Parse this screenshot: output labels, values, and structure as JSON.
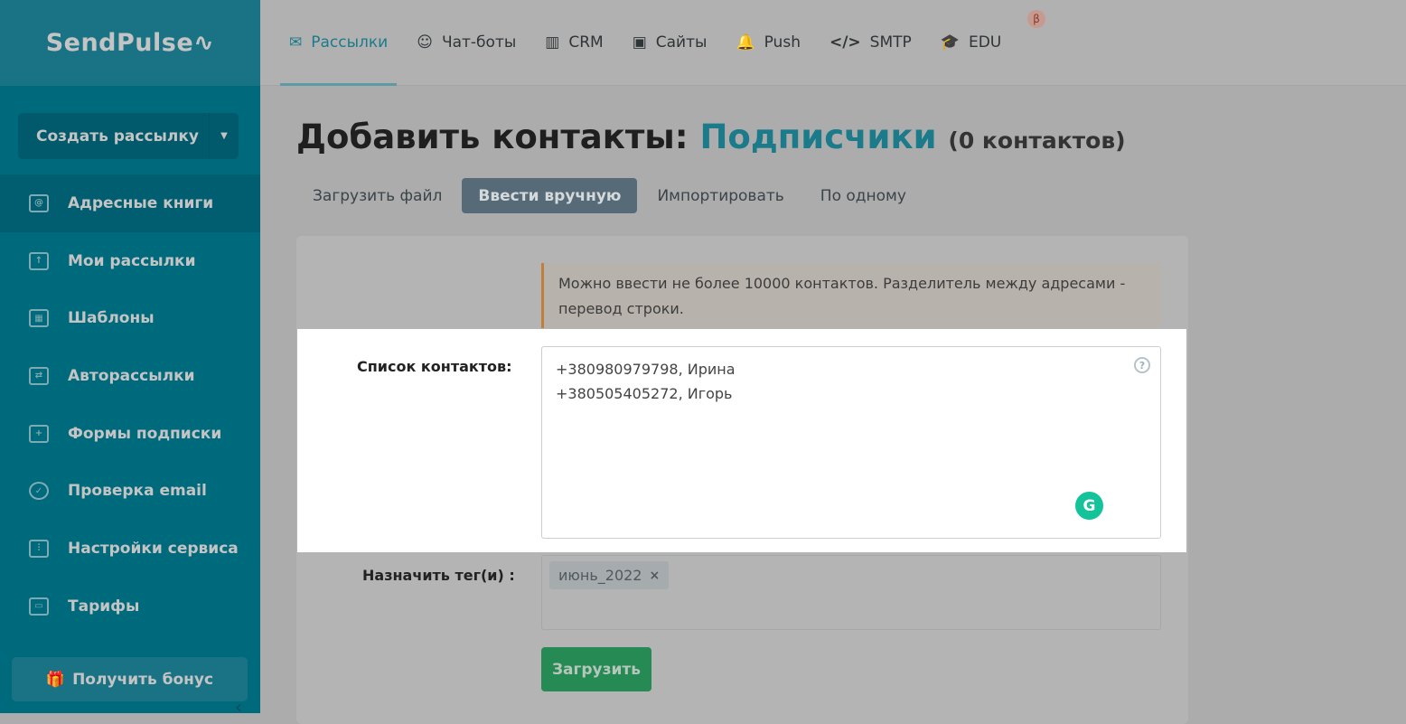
{
  "sidebar": {
    "logo": "SendPulse",
    "create": "Создать рассылку",
    "items": [
      {
        "label": "Адресные книги",
        "icon": "address-book-icon"
      },
      {
        "label": "Мои рассылки",
        "icon": "upload-icon"
      },
      {
        "label": "Шаблоны",
        "icon": "template-icon"
      },
      {
        "label": "Авторассылки",
        "icon": "automation-icon"
      },
      {
        "label": "Формы подписки",
        "icon": "form-icon"
      },
      {
        "label": "Проверка email",
        "icon": "check-icon"
      },
      {
        "label": "Настройки сервиса",
        "icon": "settings-icon"
      },
      {
        "label": "Тарифы",
        "icon": "wallet-icon"
      }
    ],
    "bonus": "Получить бонус"
  },
  "topnav": [
    {
      "label": "Рассылки",
      "icon": "✉"
    },
    {
      "label": "Чат-боты",
      "icon": "☺"
    },
    {
      "label": "CRM",
      "icon": "▥"
    },
    {
      "label": "Сайты",
      "icon": "▣"
    },
    {
      "label": "Push",
      "icon": "🔔"
    },
    {
      "label": "SMTP",
      "icon": "</>"
    },
    {
      "label": "EDU",
      "icon": "🎓"
    }
  ],
  "beta": "β",
  "title": {
    "prefix": "Добавить контакты:",
    "book": "Подписчики",
    "count": "(0 контактов)"
  },
  "tabs": [
    "Загрузить файл",
    "Ввести вручную",
    "Импортировать",
    "По одному"
  ],
  "notice": "Можно ввести не более 10000 контактов. Разделитель между адресами - перевод строки.",
  "form": {
    "contacts_label": "Список контактов:",
    "contacts_value": "+380980979798, Ирина\n+380505405272, Игорь",
    "tags_label": "Назначить тег(и) :",
    "tag": "июнь_2022",
    "submit": "Загрузить"
  }
}
